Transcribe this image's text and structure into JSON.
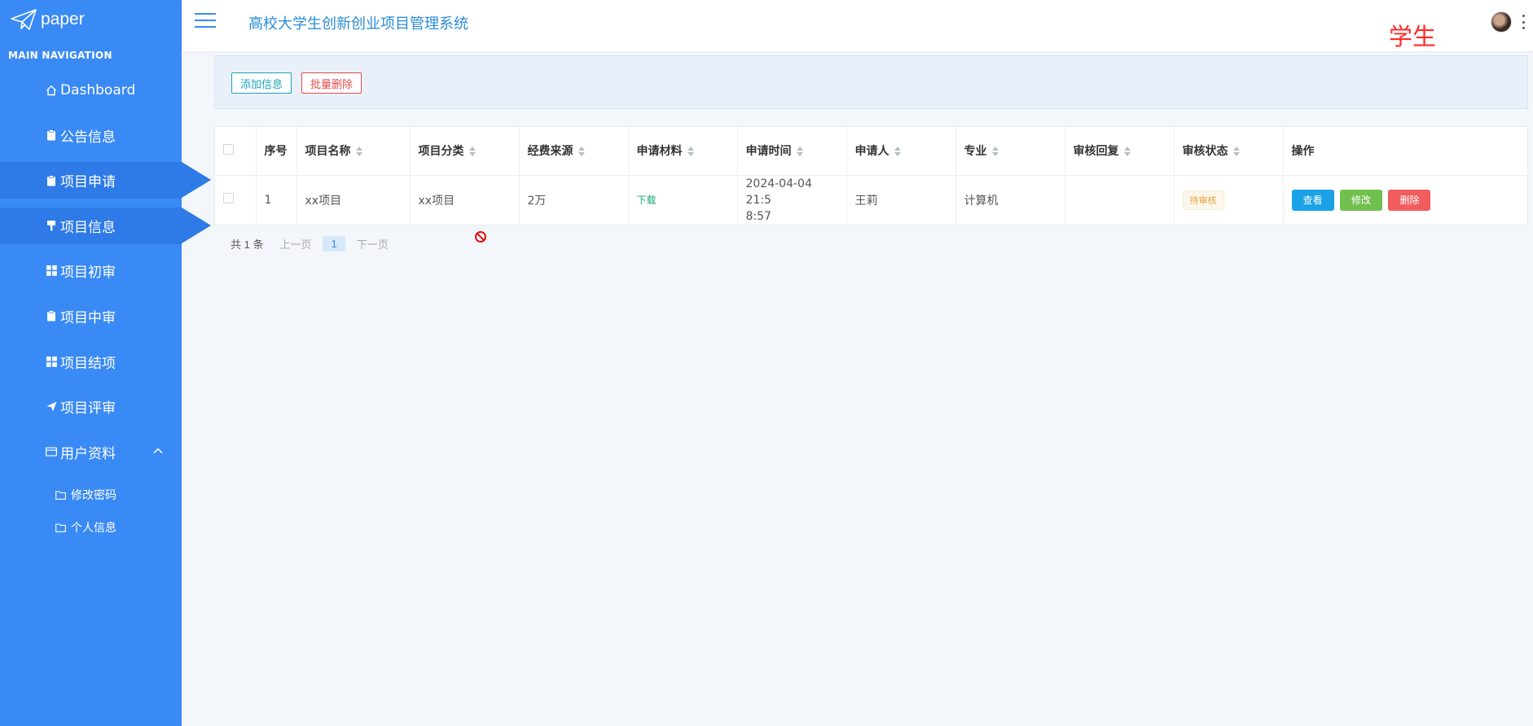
{
  "sidebar": {
    "logo_text": "paper",
    "nav_title": "MAIN NAVIGATION",
    "items": [
      {
        "label": "Dashboard",
        "icon": "home-icon"
      },
      {
        "label": "公告信息",
        "icon": "clipboard-icon"
      },
      {
        "label": "项目申请",
        "icon": "clipboard-icon"
      },
      {
        "label": "项目信息",
        "icon": "brush-icon"
      },
      {
        "label": "项目初审",
        "icon": "grid-icon"
      },
      {
        "label": "项目中审",
        "icon": "clipboard-icon"
      },
      {
        "label": "项目结项",
        "icon": "grid-icon"
      },
      {
        "label": "项目评审",
        "icon": "send-icon"
      },
      {
        "label": "用户资料",
        "icon": "card-icon"
      }
    ],
    "sub_items": [
      {
        "label": "修改密码",
        "icon": "folder-icon"
      },
      {
        "label": "个人信息",
        "icon": "folder-icon"
      }
    ]
  },
  "header": {
    "title": "高校大学生创新创业项目管理系统",
    "role": "学生"
  },
  "toolbar": {
    "add_label": "添加信息",
    "batch_delete_label": "批量删除"
  },
  "table": {
    "headers": [
      "序号",
      "项目名称",
      "项目分类",
      "经费来源",
      "申请材料",
      "申请时间",
      "申请人",
      "专业",
      "审核回复",
      "审核状态",
      "操作"
    ],
    "rows": [
      {
        "index": "1",
        "name": "xx项目",
        "category": "xx项目",
        "funding": "2万",
        "material": "下载",
        "time_line1": "2024-04-04 21:5",
        "time_line2": "8:57",
        "applicant": "王莉",
        "major": "计算机",
        "reply": "",
        "status": "待审核",
        "actions": {
          "view": "查看",
          "edit": "修改",
          "delete": "删除"
        }
      }
    ]
  },
  "pagination": {
    "total": "共 1 条",
    "prev": "上一页",
    "current": "1",
    "next": "下一页"
  },
  "colors": {
    "sidebar": "#3a8af5",
    "sidebar_active": "#2e7ae6",
    "title": "#2b8cd6",
    "role": "#ff2a2a",
    "view_button": "#1aa1e6",
    "edit_button": "#71c04f",
    "delete_button": "#f15c5c",
    "pending_badge": "#e6a23c"
  }
}
